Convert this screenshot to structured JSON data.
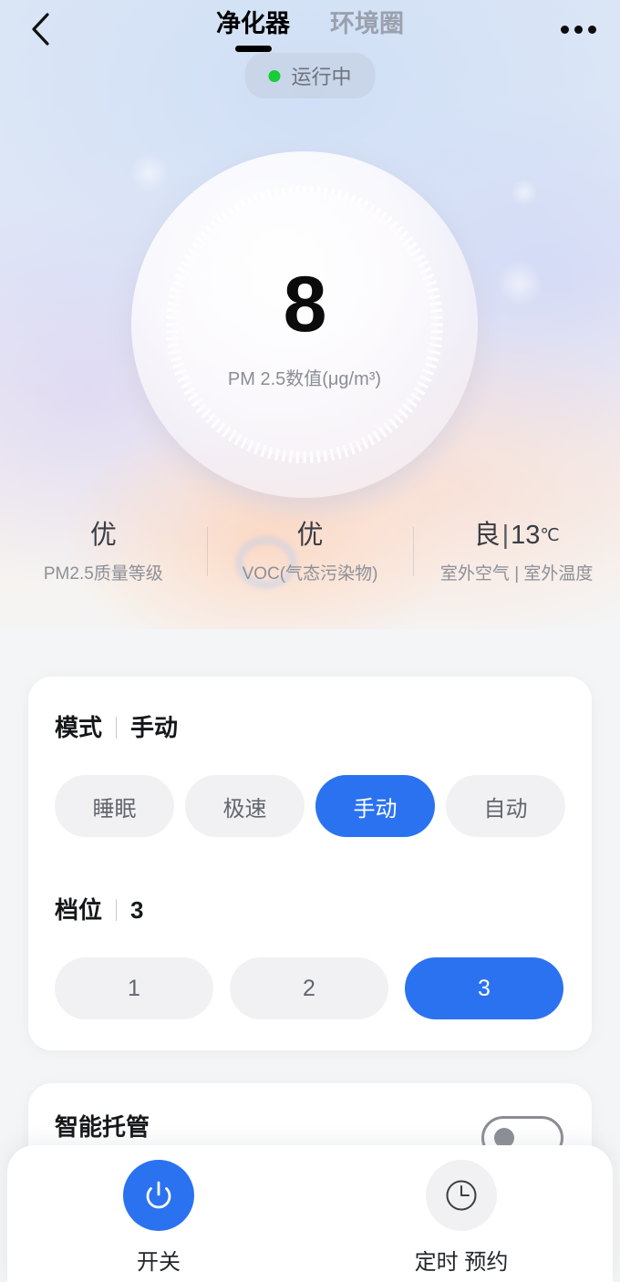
{
  "topbar": {
    "back_icon": "chevron-left-icon",
    "more_icon": "ellipsis-icon",
    "tabs": [
      {
        "label": "净化器",
        "active": true
      },
      {
        "label": "环境圈",
        "active": false
      }
    ]
  },
  "status": {
    "text": "运行中",
    "dot_color": "#16cc37"
  },
  "hero": {
    "pm_value": "8",
    "pm_label": "PM 2.5数值(μg/m³)",
    "stats": [
      {
        "value": "优",
        "sub": "PM2.5质量等级"
      },
      {
        "value": "优",
        "sub": "VOC(气态污染物)"
      },
      {
        "value_a": "良",
        "value_sep": "|",
        "value_b": "13",
        "value_unit": "℃",
        "sub": "室外空气 | 室外温度"
      }
    ]
  },
  "mode_card": {
    "title": "模式",
    "current": "手动",
    "chips": [
      {
        "label": "睡眠",
        "selected": false
      },
      {
        "label": "极速",
        "selected": false
      },
      {
        "label": "手动",
        "selected": true
      },
      {
        "label": "自动",
        "selected": false
      }
    ]
  },
  "gear_card": {
    "title": "档位",
    "current": "3",
    "chips": [
      {
        "label": "1",
        "selected": false
      },
      {
        "label": "2",
        "selected": false
      },
      {
        "label": "3",
        "selected": true
      }
    ]
  },
  "smart_card": {
    "title": "智能托管",
    "toggle_state": "off"
  },
  "bottombar": {
    "items": [
      {
        "label": "开关",
        "icon": "power-icon",
        "active": true
      },
      {
        "label": "定时 预约",
        "icon": "clock-icon",
        "active": false
      }
    ]
  },
  "colors": {
    "accent": "#2b72f0",
    "chip_bg": "#f1f1f3",
    "page_bg": "#f4f5f6",
    "status_green": "#16cc37"
  }
}
